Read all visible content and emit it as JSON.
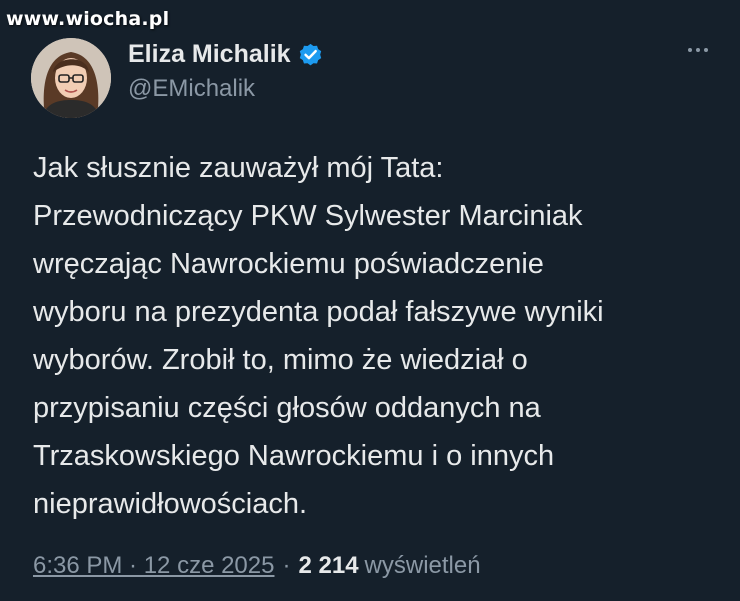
{
  "watermark": "www.wiocha.pl",
  "author": {
    "display_name": "Eliza Michalik",
    "handle": "@EMichalik",
    "verified_color": "#1d9bf0"
  },
  "tweet": {
    "text": "Jak słusznie zauważył mój Tata:\nPrzewodniczący PKW Sylwester Marciniak\nwręczając Nawrockiemu poświadczenie\nwyboru na prezydenta podał fałszywe wyniki\nwyborów. Zrobił to, mimo że wiedział o\nprzypisaniu części głosów oddanych na\nTrzaskowskiego Nawrockiemu i o innych\nnieprawidłowościach.",
    "time": "6:36 PM · 12 cze 2025",
    "separator": "·",
    "views_count": "2 214",
    "views_label": "wyświetleń"
  },
  "colors": {
    "background": "#15202b",
    "text": "#e7e9ea",
    "secondary": "#8b98a5"
  },
  "icons": {
    "more": "more-horizontal-icon",
    "verified": "verified-badge-icon"
  }
}
